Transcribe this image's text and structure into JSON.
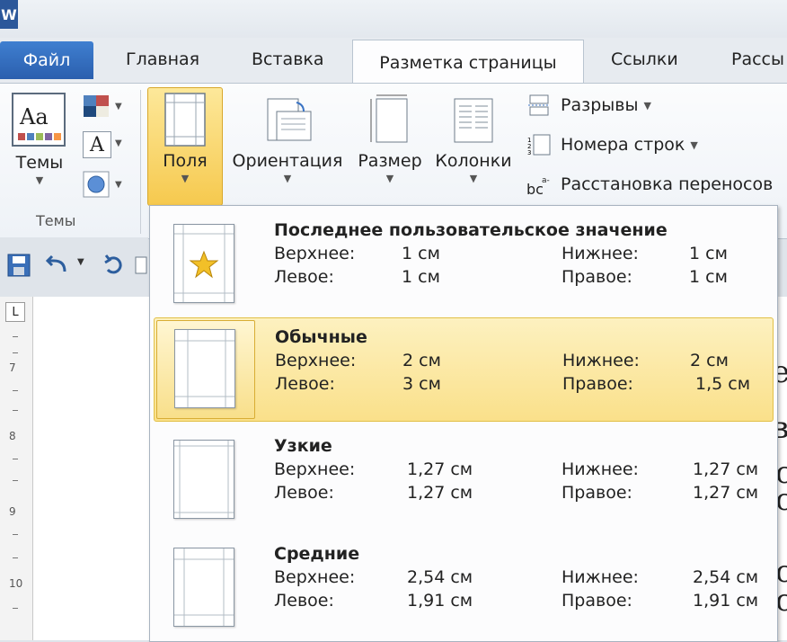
{
  "app": {
    "logo_letter": "W"
  },
  "tabs": [
    {
      "label": "Файл"
    },
    {
      "label": "Главная"
    },
    {
      "label": "Вставка"
    },
    {
      "label": "Разметка страницы"
    },
    {
      "label": "Ссылки"
    },
    {
      "label": "Рассы"
    }
  ],
  "ribbon": {
    "themes_label": "Темы",
    "themes_group_label": "Темы",
    "fields_label": "Поля",
    "orientation_label": "Ориентация",
    "size_label": "Размер",
    "columns_label": "Колонки",
    "breaks_label": "Разрывы",
    "line_numbers_label": "Номера строк",
    "hyphenation_label": "Расстановка переносов",
    "hyphen_icon_text": "bc",
    "hyphen_icon_super": "a-",
    "font_icon_letter": "A",
    "theme_icon_text": "Aa"
  },
  "ruler": {
    "numbers": [
      "7",
      "8",
      "9",
      "10"
    ],
    "corner": "L"
  },
  "document": {
    "visible_chars": [
      "е",
      "в",
      "с",
      "с",
      "с",
      "с"
    ]
  },
  "margins": {
    "items": [
      {
        "title": "Последнее пользовательское значение",
        "top_label": "Верхнее:",
        "top": "1 см",
        "bottom_label": "Нижнее:",
        "bottom": "1 см",
        "left_label": "Левое:",
        "left": "1 см",
        "right_label": "Правое:",
        "right": "1 см",
        "selected": false
      },
      {
        "title": "Обычные",
        "top_label": "Верхнее:",
        "top": "2 см",
        "bottom_label": "Нижнее:",
        "bottom": "2 см",
        "left_label": "Левое:",
        "left": "3 см",
        "right_label": "Правое:",
        "right": "1,5 см",
        "selected": true
      },
      {
        "title": "Узкие",
        "top_label": "Верхнее:",
        "top": "1,27 см",
        "bottom_label": "Нижнее:",
        "bottom": "1,27 см",
        "left_label": "Левое:",
        "left": "1,27 см",
        "right_label": "Правое:",
        "right": "1,27 см",
        "selected": false
      },
      {
        "title": "Средние",
        "top_label": "Верхнее:",
        "top": "2,54 см",
        "bottom_label": "Нижнее:",
        "bottom": "2,54 см",
        "left_label": "Левое:",
        "left": "1,91 см",
        "right_label": "Правое:",
        "right": "1,91 см",
        "selected": false
      }
    ]
  },
  "colors": {
    "file_tab": "#2b5fae",
    "highlight": "#fae08a",
    "star": "#f2c028"
  }
}
